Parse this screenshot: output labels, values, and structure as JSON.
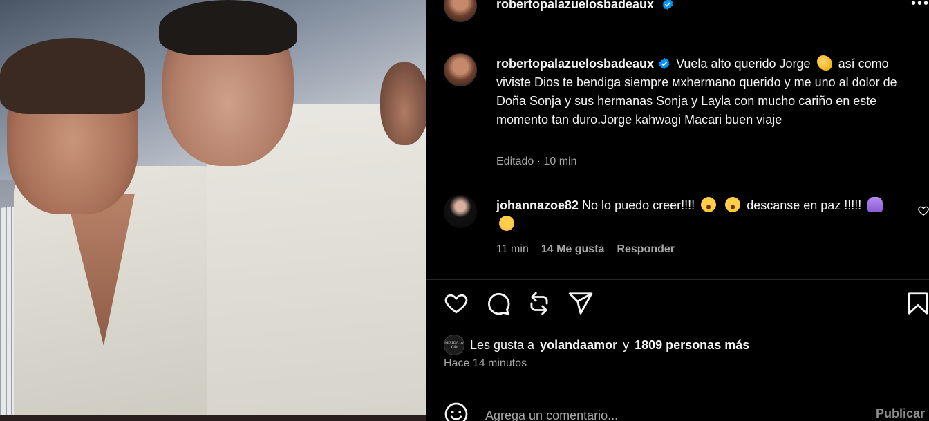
{
  "post": {
    "author": "robertopalazuelosbadeaux",
    "more_label": "•••"
  },
  "caption": {
    "username": "robertopalazuelosbadeaux",
    "text_1": "Vuela alto querido Jorge",
    "text_2": "así como viviste Dios te bendiga siempre мxhermano querido y me uno al dolor de Doña Sonja y sus hermanas Sonja y Layla con mucho cariño en este momento tan duro.Jorge kahwagi Macari buen viaje",
    "meta": "Editado · 10 min"
  },
  "comment": {
    "username": "johannazoe82",
    "text_1": "No lo puedo creer!!!!",
    "text_2": "descanse en paz !!!!!",
    "time": "11 min",
    "likes": "14 Me gusta",
    "reply": "Responder"
  },
  "likes": {
    "prefix": "Les gusta a",
    "user": "yolandaamor",
    "joiner": "y",
    "count": "1809 personas más",
    "avatar_text": "MIXIDA by Yoly"
  },
  "time_ago": "Hace 14 minutos",
  "comment_input": {
    "placeholder": "Agrega un comentario...",
    "publish_label": "Publicar"
  },
  "icons": {
    "like": "heart-icon",
    "comment": "comment-icon",
    "repost": "repost-icon",
    "share": "share-icon",
    "save": "bookmark-icon",
    "emoji": "smiley-icon"
  },
  "colors": {
    "background": "#000000",
    "text": "#f5f5f5",
    "muted": "#a8a8a8",
    "verified": "#0095f6"
  }
}
